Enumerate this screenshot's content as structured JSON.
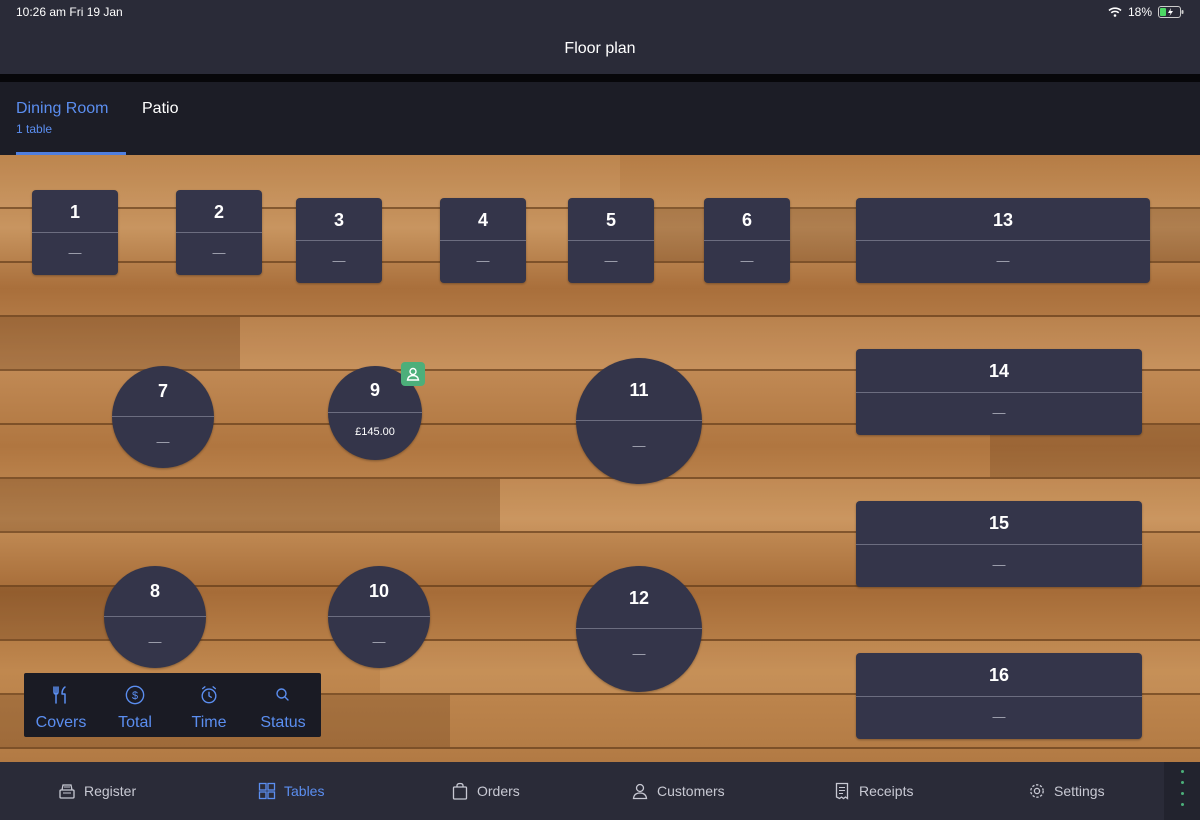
{
  "status_bar": {
    "time": "10:26 am  Fri 19 Jan",
    "battery": "18%"
  },
  "title": "Floor plan",
  "tabs": [
    {
      "label": "Dining Room",
      "sub": "1 table",
      "active": true
    },
    {
      "label": "Patio",
      "sub": "",
      "active": false
    }
  ],
  "tables": [
    {
      "number": "1",
      "value": "—"
    },
    {
      "number": "2",
      "value": "—"
    },
    {
      "number": "3",
      "value": "—"
    },
    {
      "number": "4",
      "value": "—"
    },
    {
      "number": "5",
      "value": "—"
    },
    {
      "number": "6",
      "value": "—"
    },
    {
      "number": "7",
      "value": "—"
    },
    {
      "number": "8",
      "value": "—"
    },
    {
      "number": "9",
      "value": "£145.00",
      "occupied": true
    },
    {
      "number": "10",
      "value": "—"
    },
    {
      "number": "11",
      "value": "—"
    },
    {
      "number": "12",
      "value": "—"
    },
    {
      "number": "13",
      "value": "—"
    },
    {
      "number": "14",
      "value": "—"
    },
    {
      "number": "15",
      "value": "—"
    },
    {
      "number": "16",
      "value": "—"
    }
  ],
  "view_toggles": [
    {
      "label": "Covers",
      "icon": "cutlery-icon"
    },
    {
      "label": "Total",
      "icon": "dollar-icon"
    },
    {
      "label": "Time",
      "icon": "clock-icon"
    },
    {
      "label": "Status",
      "icon": "search-icon"
    }
  ],
  "bottom_nav": [
    {
      "label": "Register",
      "icon": "register-icon",
      "active": false
    },
    {
      "label": "Tables",
      "icon": "tables-icon",
      "active": true
    },
    {
      "label": "Orders",
      "icon": "bag-icon",
      "active": false
    },
    {
      "label": "Customers",
      "icon": "person-icon",
      "active": false
    },
    {
      "label": "Receipts",
      "icon": "receipt-icon",
      "active": false
    },
    {
      "label": "Settings",
      "icon": "gear-icon",
      "active": false
    }
  ],
  "colors": {
    "accent": "#5b8ef0",
    "table": "#34354a",
    "occupied_badge": "#4caf7a",
    "bar": "#2a2b38"
  }
}
